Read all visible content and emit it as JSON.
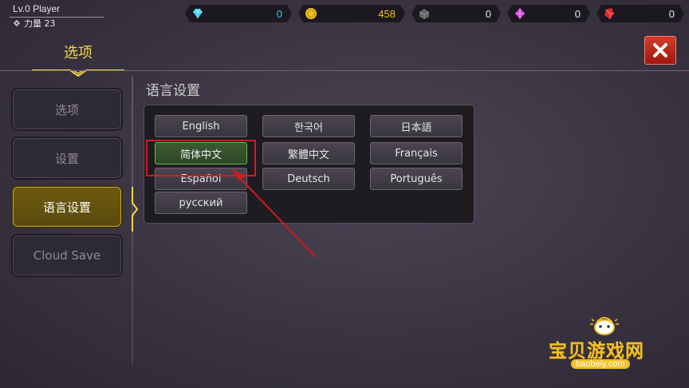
{
  "player": {
    "name": "Lv.0 Player",
    "power": "力量 23"
  },
  "currencies": [
    {
      "icon": "diamond-icon",
      "value": "0",
      "color": "#42c8f0"
    },
    {
      "icon": "gold-coin-icon",
      "value": "458",
      "color": "#f0c020"
    },
    {
      "icon": "iron-ore-icon",
      "value": "0",
      "color": "#777777"
    },
    {
      "icon": "purple-gem-icon",
      "value": "0",
      "color": "#d94ae0"
    },
    {
      "icon": "red-crystal-icon",
      "value": "0",
      "color": "#e02828"
    }
  ],
  "header": {
    "title": "选项"
  },
  "sidebar": {
    "items": [
      {
        "label": "选项",
        "active": false
      },
      {
        "label": "设置",
        "active": false
      },
      {
        "label": "语言设置",
        "active": true
      },
      {
        "label": "Cloud Save",
        "active": false
      }
    ]
  },
  "language": {
    "title": "语言设置",
    "options": [
      "English",
      "한국어",
      "日本語",
      "简体中文",
      "繁體中文",
      "Français",
      "Español",
      "Deutsch",
      "Português",
      "русский"
    ],
    "selected": "简体中文"
  },
  "watermark": {
    "brand": "宝贝游戏网",
    "url": "baobeiy.com"
  },
  "colors": {
    "accent_gold": "#f5d64a",
    "close_red": "#c8281a",
    "selected_green": "#5ec04a",
    "highlight_red": "#d21c1c"
  }
}
